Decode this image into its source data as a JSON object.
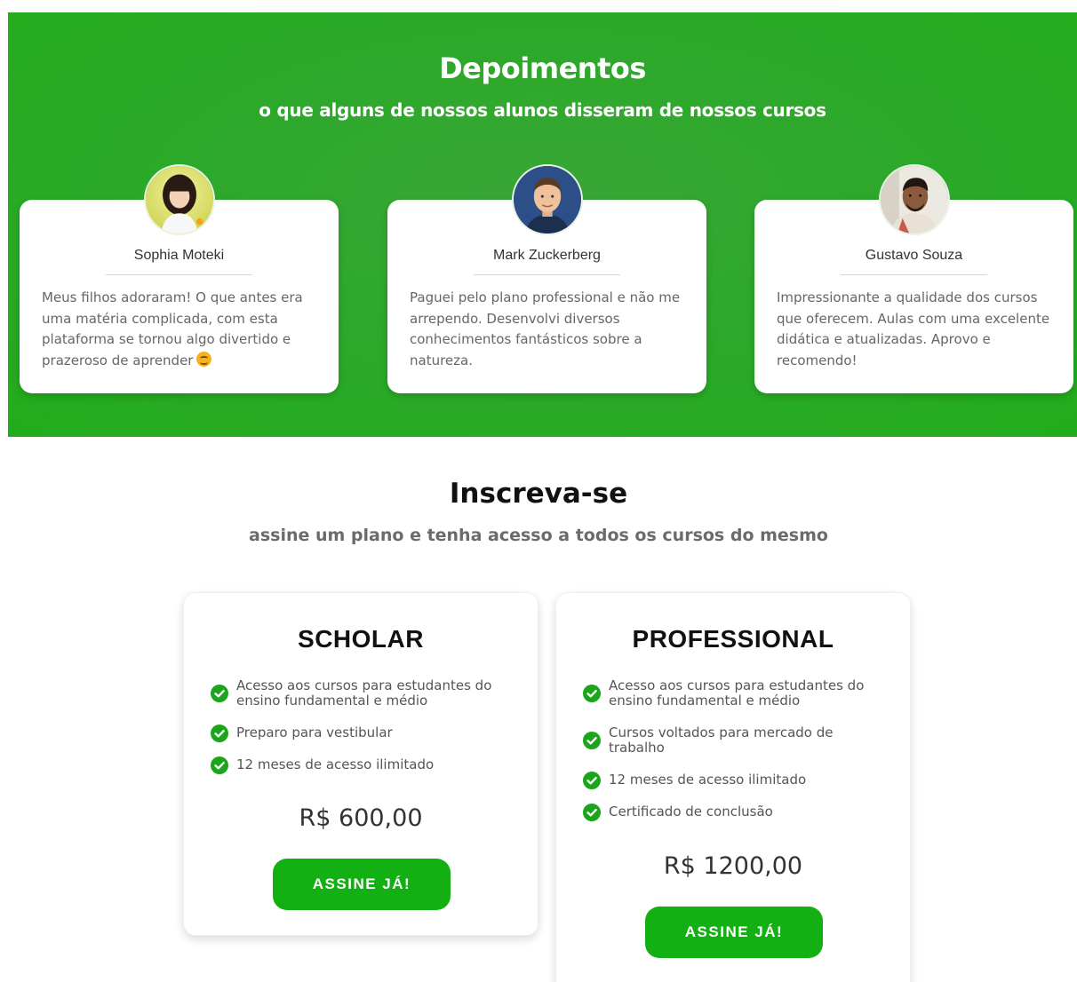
{
  "testimonials": {
    "title": "Depoimentos",
    "subtitle": "o que alguns de nossos alunos disseram de nossos cursos",
    "items": [
      {
        "name": "Sophia Moteki",
        "text": "Meus filhos adoraram! O que antes era uma matéria complicada, com esta plataforma se tornou algo divertido e prazeroso de aprender",
        "emoji": "smiling-face-emoji"
      },
      {
        "name": "Mark Zuckerberg",
        "text": "Paguei pelo plano professional e não me arrependo. Desenvolvi diversos conhecimentos fantásticos sobre a natureza."
      },
      {
        "name": "Gustavo Souza",
        "text": "Impressionante a qualidade dos cursos que oferecem. Aulas com uma excelente didática e atualizadas. Aprovo e recomendo!"
      }
    ]
  },
  "pricing": {
    "title": "Inscreva-se",
    "subtitle": "assine um plano e tenha acesso a todos os cursos do mesmo",
    "plans": [
      {
        "name": "SCHOLAR",
        "features": [
          "Acesso aos cursos para estudantes do ensino fundamental e médio",
          "Preparo para vestibular",
          "12 meses de acesso ilimitado"
        ],
        "price": "R$ 600,00",
        "button": "ASSINE JÁ!"
      },
      {
        "name": "PROFESSIONAL",
        "features": [
          "Acesso aos cursos para estudantes do ensino fundamental e médio",
          "Cursos voltados para mercado de trabalho",
          "12 meses de acesso ilimitado",
          "Certificado de conclusão"
        ],
        "price": "R$ 1200,00",
        "button": "ASSINE JÁ!"
      }
    ]
  },
  "colors": {
    "brand_green": "#2aa928",
    "button_green": "#12b012",
    "check_green": "#1aa51a"
  },
  "icons": {
    "feature_check": "check-circle-icon"
  }
}
